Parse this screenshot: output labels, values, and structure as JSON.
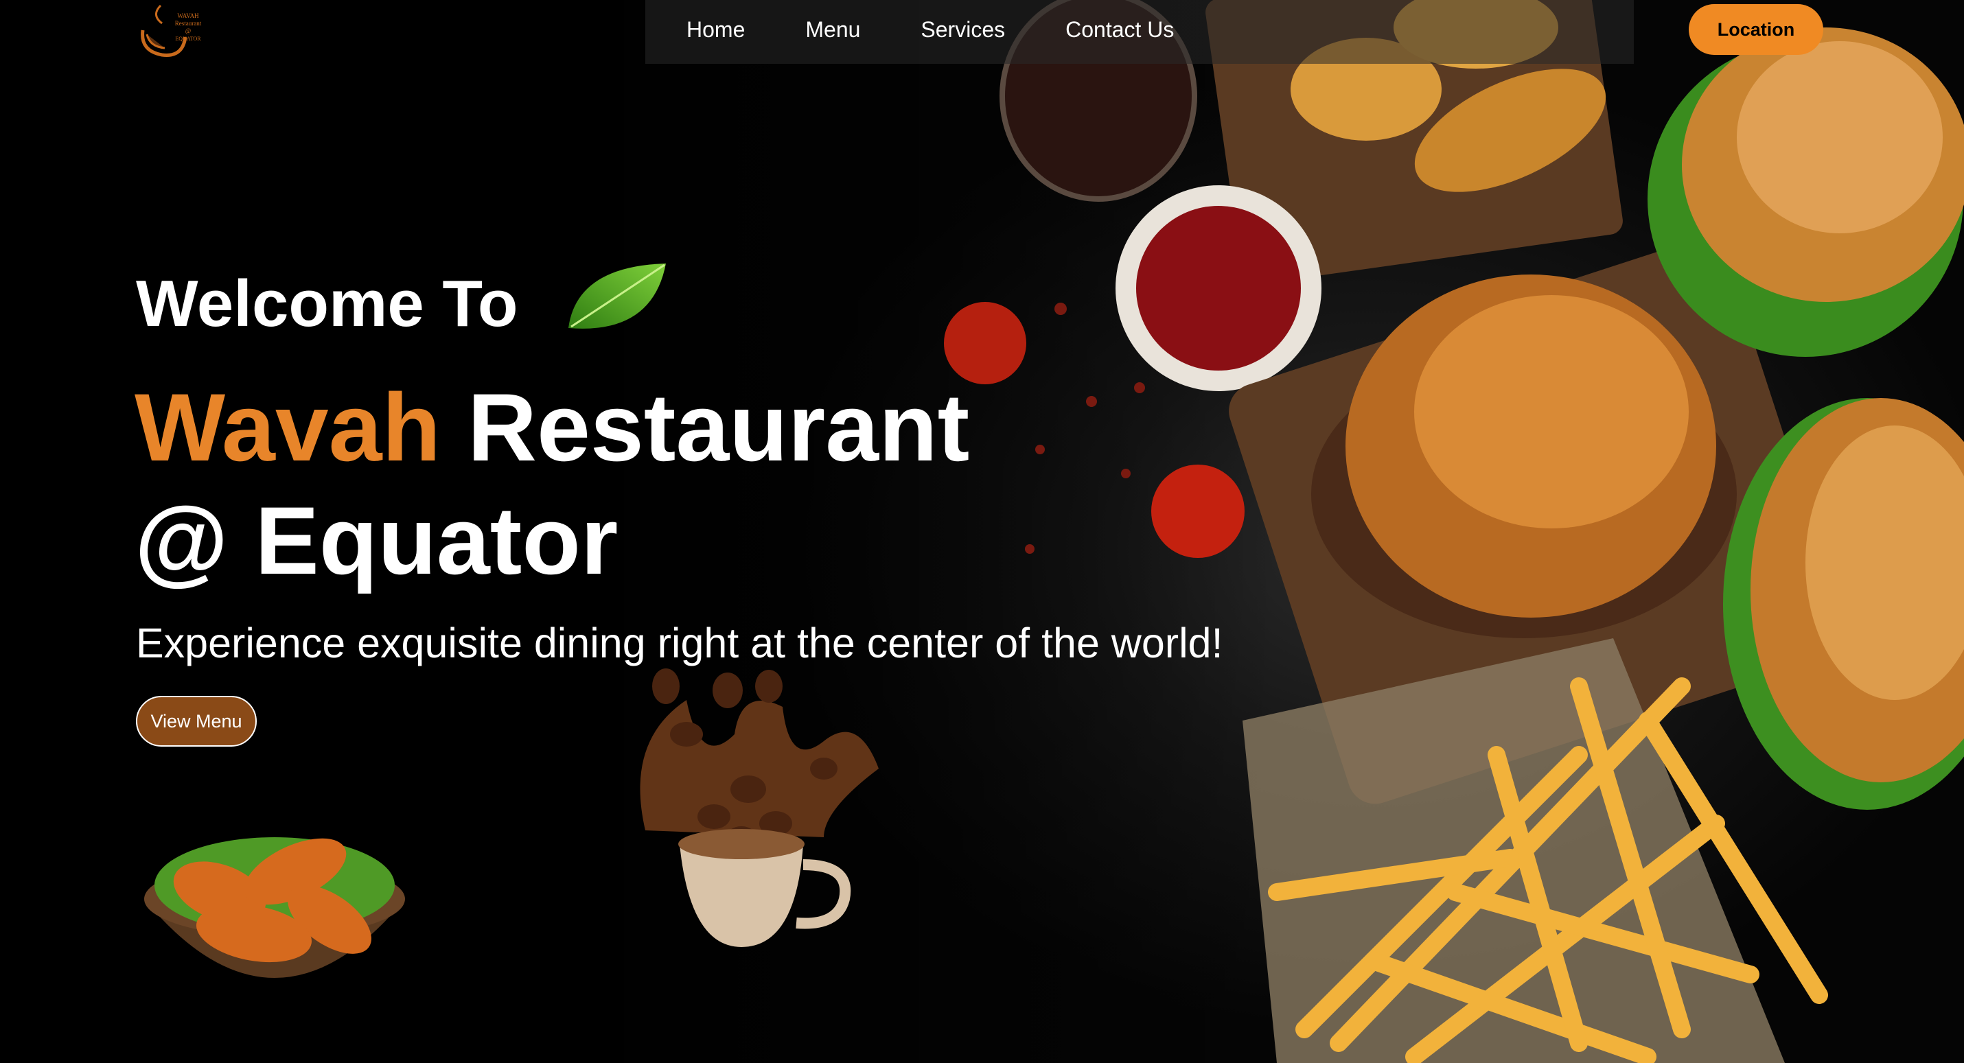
{
  "logo": {
    "line1": "WAVAH",
    "line2": "Restaurant",
    "line3": "@",
    "line4": "EQUATOR"
  },
  "nav": {
    "links": [
      "Home",
      "Menu",
      "Services",
      "Contact Us"
    ],
    "location_label": "Location"
  },
  "hero": {
    "welcome": "Welcome To",
    "brand": "Wavah",
    "title_rest": "Restaurant",
    "title_line2": "@ Equator",
    "tagline": "Experience exquisite dining right at the center of the world!",
    "cta_label": "View Menu"
  },
  "colors": {
    "accent": "#f08a23",
    "brand_text": "#e8852a",
    "cta_bg": "#8a4a17"
  }
}
